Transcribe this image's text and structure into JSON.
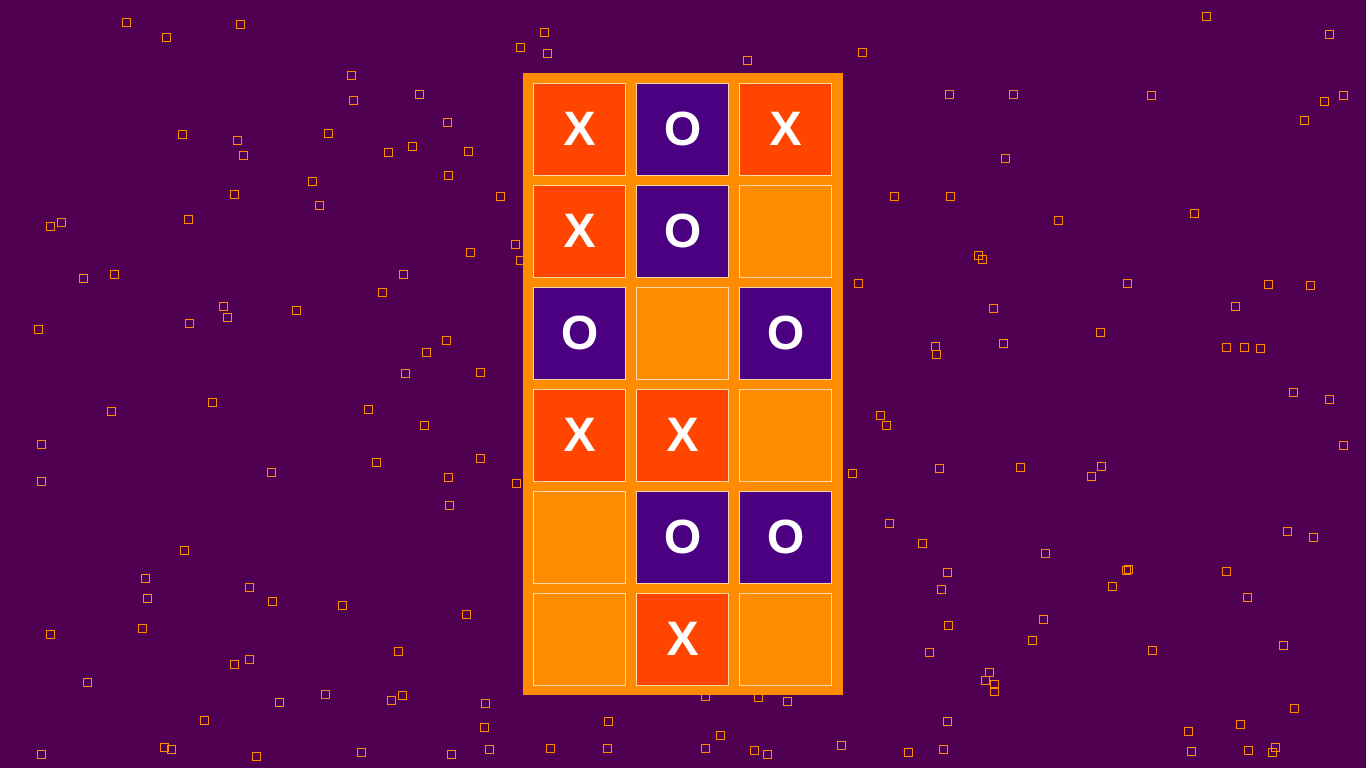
{
  "colors": {
    "background": "#4f0050",
    "board": "#ff8c00",
    "x_cell": "#ff4500",
    "o_cell": "#4b0082",
    "empty_cell": "#ff8c00",
    "mark_text": "#ffffff",
    "decor_square_outline": "#ff8c00"
  },
  "board": {
    "rows": 6,
    "cols": 3,
    "cells": [
      [
        "X",
        "O",
        "X"
      ],
      [
        "X",
        "O",
        ""
      ],
      [
        "O",
        "",
        "O"
      ],
      [
        "X",
        "X",
        ""
      ],
      [
        "",
        "O",
        "O"
      ],
      [
        "",
        "X",
        ""
      ]
    ]
  }
}
